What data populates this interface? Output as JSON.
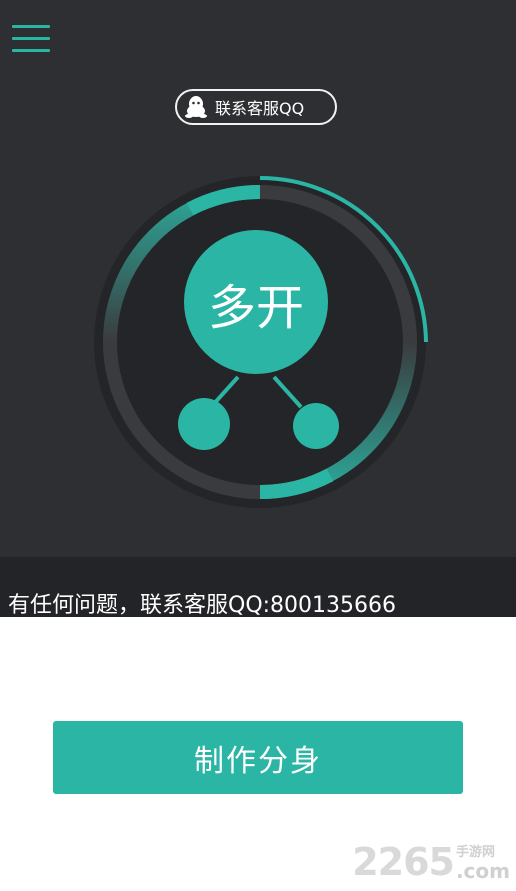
{
  "header": {
    "menu_icon": "hamburger-menu-icon",
    "qq_button": {
      "icon": "qq-penguin-icon",
      "label": "联系客服QQ"
    }
  },
  "dial": {
    "center_label": "多开",
    "accent_color": "#2bb5a4",
    "ring_color": "#3a3b3e"
  },
  "marquee": {
    "text": "有任何问题，联系客服QQ:800135666"
  },
  "main": {
    "create_button_label": "制作分身"
  },
  "watermark": {
    "number": "2265",
    "cn": "手游网",
    "suffix": ".com"
  },
  "colors": {
    "dark_bg": "#2e2f32",
    "strip_bg": "#232427",
    "accent": "#2bb5a4",
    "white": "#ffffff"
  }
}
